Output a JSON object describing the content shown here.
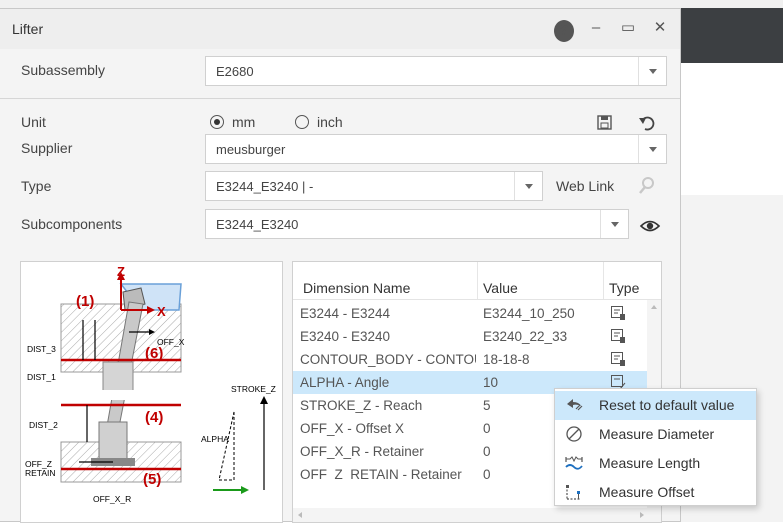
{
  "dialog": {
    "title": "Lifter"
  },
  "subassembly": {
    "label": "Subassembly",
    "value": "E2680"
  },
  "unit": {
    "label": "Unit",
    "options": [
      "mm",
      "inch"
    ],
    "selected": "mm"
  },
  "supplier": {
    "label": "Supplier",
    "value": "meusburger"
  },
  "type": {
    "label": "Type",
    "value": "E3244_E3240 | -",
    "web_link": "Web Link"
  },
  "subcomponents": {
    "label": "Subcomponents",
    "value": "E3244_E3240"
  },
  "diagram": {
    "labels": {
      "z": "Z",
      "x": "X",
      "n1": "(1)",
      "n6": "(6)",
      "n4": "(4)",
      "n5": "(5)",
      "dist3": "DIST_3",
      "dist1": "DIST_1",
      "dist2": "DIST_2",
      "offx": "OFF_X",
      "offz": "OFF_Z",
      "retain": "RETAIN",
      "offxr": "OFF_X_R",
      "strokez": "STROKE_Z",
      "alpha": "ALPHA"
    }
  },
  "grid": {
    "columns": [
      "Dimension Name",
      "Value",
      "Type"
    ],
    "rows": [
      {
        "name": "E3244 - E3244",
        "value": "E3244_10_250"
      },
      {
        "name": "E3240 - E3240",
        "value": "E3240_22_33"
      },
      {
        "name": "CONTOUR_BODY - CONTOUR_BODY",
        "value": "18-18-8"
      },
      {
        "name": "ALPHA - Angle",
        "value": "10",
        "selected": true
      },
      {
        "name": "STROKE_Z - Reach",
        "value": "5"
      },
      {
        "name": "OFF_X - Offset X",
        "value": "0"
      },
      {
        "name": "OFF_X_R - Retainer",
        "value": "0"
      },
      {
        "name": "OFF_Z_RETAIN - Retainer",
        "value": "0"
      }
    ]
  },
  "context_menu": {
    "items": [
      {
        "label": "Reset to default value",
        "icon": "reset-icon"
      },
      {
        "label": "Measure Diameter",
        "icon": "diameter-icon"
      },
      {
        "label": "Measure Length",
        "icon": "length-icon"
      },
      {
        "label": "Measure Offset",
        "icon": "offset-icon"
      }
    ]
  },
  "colors": {
    "accent": "#1e70c0",
    "selection": "#cce8fb",
    "diagram_red": "#c00000"
  }
}
